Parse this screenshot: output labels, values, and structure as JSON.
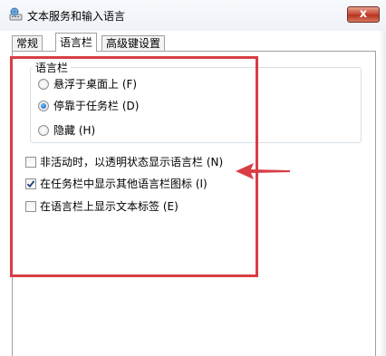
{
  "window": {
    "title": "文本服务和输入语言",
    "close_label": "x"
  },
  "tabs": [
    {
      "label": "常规",
      "active": false
    },
    {
      "label": "语言栏",
      "active": true
    },
    {
      "label": "高级键设置",
      "active": false
    }
  ],
  "language_bar_group": {
    "title": "语言栏",
    "options": [
      {
        "label": "悬浮于桌面上 (F)",
        "selected": false
      },
      {
        "label": "停靠于任务栏 (D)",
        "selected": true
      },
      {
        "label": "隐藏 (H)",
        "selected": false
      }
    ]
  },
  "checkboxes": [
    {
      "label": "非活动时，以透明状态显示语言栏 (N)",
      "checked": false
    },
    {
      "label": "在任务栏中显示其他语言栏图标 (I)",
      "checked": true
    },
    {
      "label": "在语言栏上显示文本标签 (E)",
      "checked": false
    }
  ],
  "colors": {
    "annotation_red": "#d83d45",
    "radio_selected": "#0a5aa8",
    "close_button": "#c94e3b"
  }
}
